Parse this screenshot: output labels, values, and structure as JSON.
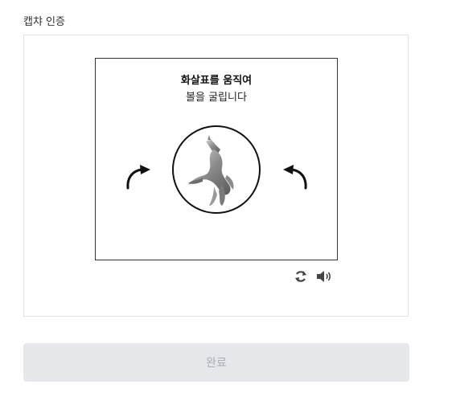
{
  "header": {
    "title": "캡챠 인증"
  },
  "captcha": {
    "instruction_line1": "화살표를 움직여",
    "instruction_line2": "볼을 굴립니다",
    "image_subject": "animal figurine",
    "left_arrow_icon": "rotate-counterclockwise-icon",
    "right_arrow_icon": "rotate-clockwise-icon"
  },
  "controls": {
    "refresh_icon": "refresh-icon",
    "audio_icon": "speaker-icon"
  },
  "footer": {
    "submit_label": "완료",
    "submit_state": "disabled"
  },
  "colors": {
    "border": "#333333",
    "button_bg": "#e6e7ea",
    "button_text": "#a9adb4"
  }
}
